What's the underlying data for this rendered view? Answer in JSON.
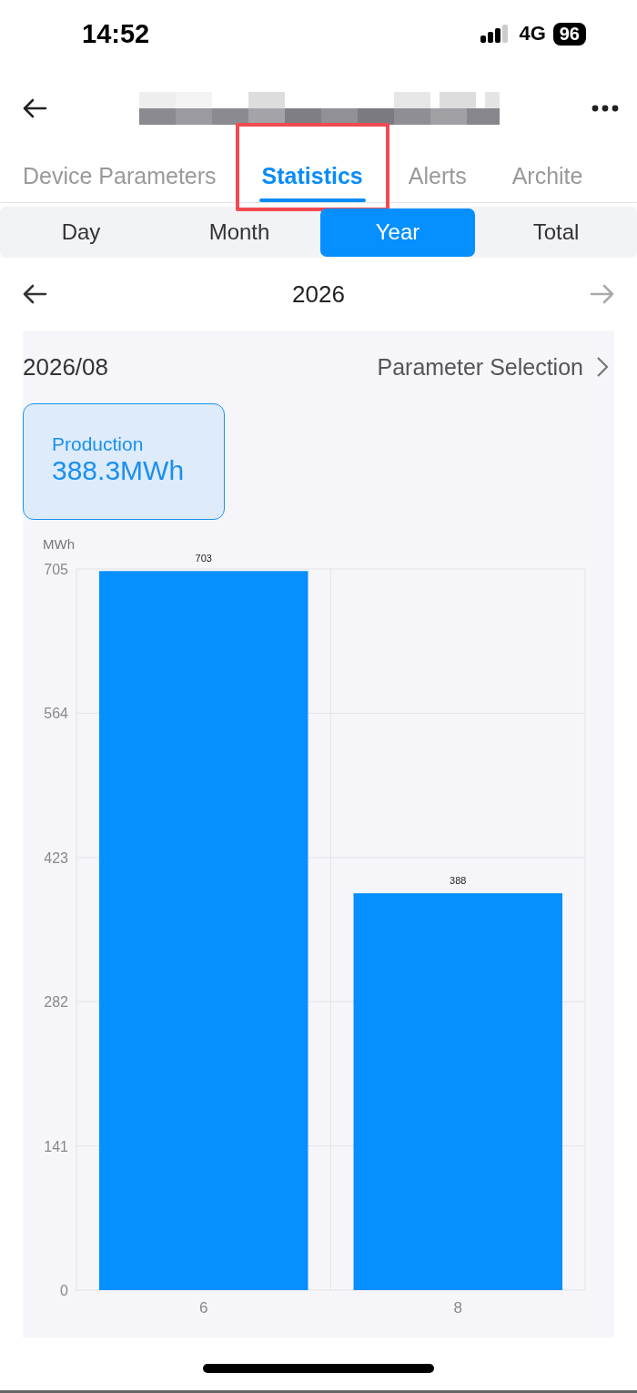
{
  "status_bar": {
    "time": "14:52",
    "network": "4G",
    "battery": "96"
  },
  "tabs": [
    {
      "label": "Device Parameters",
      "selected": false
    },
    {
      "label": "Statistics",
      "selected": true,
      "highlighted": true
    },
    {
      "label": "Alerts",
      "selected": false
    },
    {
      "label": "Archite",
      "selected": false
    }
  ],
  "periods": [
    {
      "label": "Day",
      "selected": false
    },
    {
      "label": "Month",
      "selected": false
    },
    {
      "label": "Year",
      "selected": true
    },
    {
      "label": "Total",
      "selected": false
    }
  ],
  "period_nav": {
    "label": "2026",
    "next_disabled": true
  },
  "card": {
    "date": "2026/08",
    "parameter_link": "Parameter Selection",
    "metric": {
      "label": "Production",
      "value": "388.3MWh",
      "selected": true
    },
    "chart_data": {
      "type": "bar",
      "ylabel": "MWh",
      "categories": [
        "6",
        "8"
      ],
      "series": [
        {
          "color": "#068ffe",
          "values": [
            703,
            388
          ]
        }
      ],
      "grid": true,
      "ylim": [
        0,
        705
      ],
      "yticks": [
        0,
        141,
        282,
        423,
        564,
        705
      ],
      "data_labels": true
    }
  }
}
